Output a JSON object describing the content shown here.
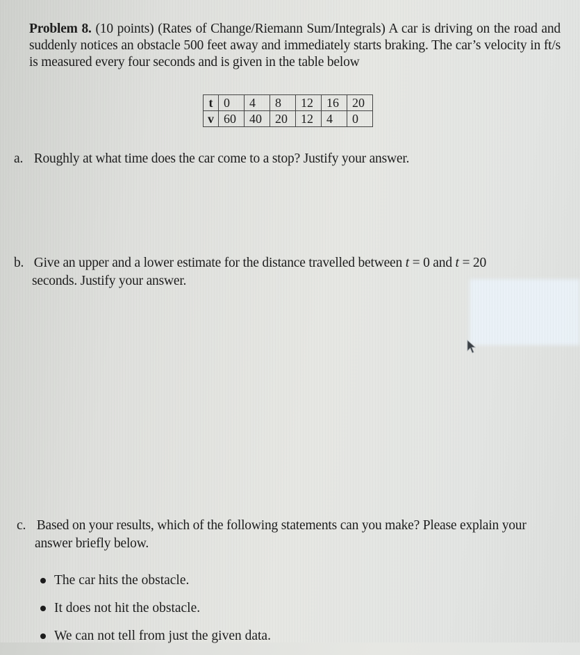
{
  "problem": {
    "label": "Problem 8.",
    "points": "(10 points)",
    "topic": "(Rates of Change/Riemann Sum/Integrals)",
    "text": "A car is driving on the road and suddenly notices an obstacle 500 feet away and immediately starts braking. The car’s velocity in ft/s is measured every four seconds and is given in the table below"
  },
  "table": {
    "rows": [
      {
        "header": "t",
        "values": [
          "0",
          "4",
          "8",
          "12",
          "16",
          "20"
        ]
      },
      {
        "header": "v",
        "values": [
          "60",
          "40",
          "20",
          "12",
          "4",
          "0"
        ]
      }
    ]
  },
  "questions": {
    "a": {
      "label": "a.",
      "text": "Roughly at what time does the car come to a stop? Justify your answer."
    },
    "b": {
      "label": "b.",
      "text_before": "Give an upper and a lower estimate for the distance travelled between",
      "math1": "t",
      "eq1": " = 0 and ",
      "math2": "t",
      "eq2": " = 20",
      "continuation": "seconds. Justify your answer."
    },
    "c": {
      "label": "c.",
      "text": "Based on your results, which of the following statements can you make? Please explain your",
      "continuation": "answer briefly below.",
      "options": [
        "The car hits the obstacle.",
        "It does not hit the obstacle.",
        "We can not tell from just the given data."
      ]
    }
  },
  "icons": {
    "cursor": "mouse-pointer-arrow"
  }
}
